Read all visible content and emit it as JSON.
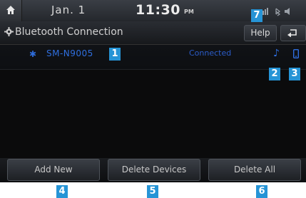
{
  "status_bar": {
    "date": "Jan. 1",
    "time": "11:30",
    "ampm": "PM",
    "icons": [
      "home-icon",
      "signal-icon",
      "bluetooth-icon",
      "volume-icon"
    ]
  },
  "header": {
    "title": "Bluetooth Connection",
    "help_label": "Help",
    "title_icon": "gear-icon",
    "back_icon": "back-arrow-icon"
  },
  "device": {
    "name": "SM-N9005",
    "status": "Connected",
    "icons": [
      "bluetooth-icon",
      "music-icon",
      "phone-icon"
    ]
  },
  "buttons": {
    "add_new": "Add New",
    "delete_devices": "Delete Devices",
    "delete_all": "Delete All"
  },
  "callouts": [
    "1",
    "2",
    "3",
    "4",
    "5",
    "6",
    "7"
  ],
  "colors": {
    "accent_blue": "#2f6fe0",
    "callout_blue": "#2694d6",
    "background": "#0b0b0c"
  }
}
